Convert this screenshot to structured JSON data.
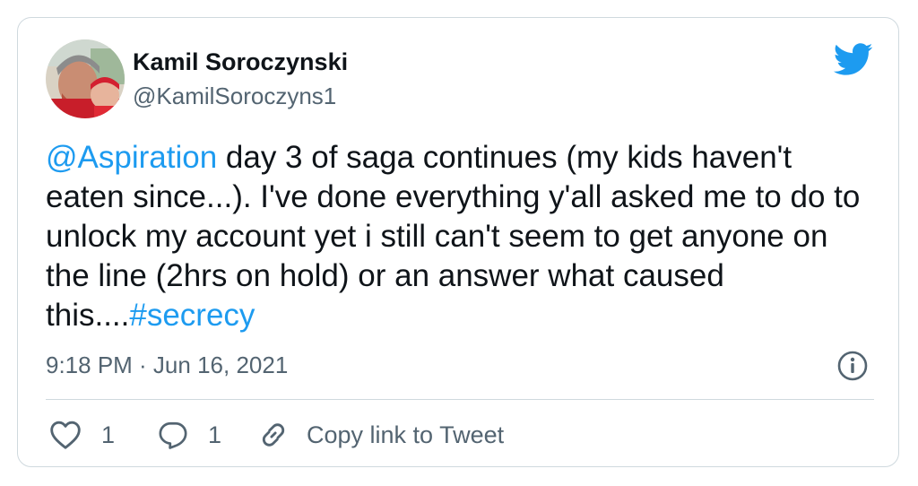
{
  "author": {
    "display_name": "Kamil Soroczynski",
    "handle": "@KamilSoroczyns1"
  },
  "tweet": {
    "mention": "@Aspiration",
    "text_1": " day 3 of saga continues (my kids haven't eaten since...).  I've done everything y'all asked me to do to unlock my account yet i still can't seem to get anyone on the line (2hrs on hold) or an answer what caused this....",
    "hashtag": "#secrecy"
  },
  "timestamp": "9:18 PM · Jun 16, 2021",
  "actions": {
    "likes": "1",
    "replies": "1",
    "copy_link": "Copy link to Tweet"
  },
  "icons": {
    "brand": "twitter-bird-icon",
    "info": "info-icon",
    "like": "heart-icon",
    "reply": "reply-bubble-icon",
    "link": "link-icon"
  },
  "colors": {
    "brand": "#1d9bf0",
    "text": "#0f1419",
    "secondary": "#536471",
    "border": "#cfd9de"
  }
}
